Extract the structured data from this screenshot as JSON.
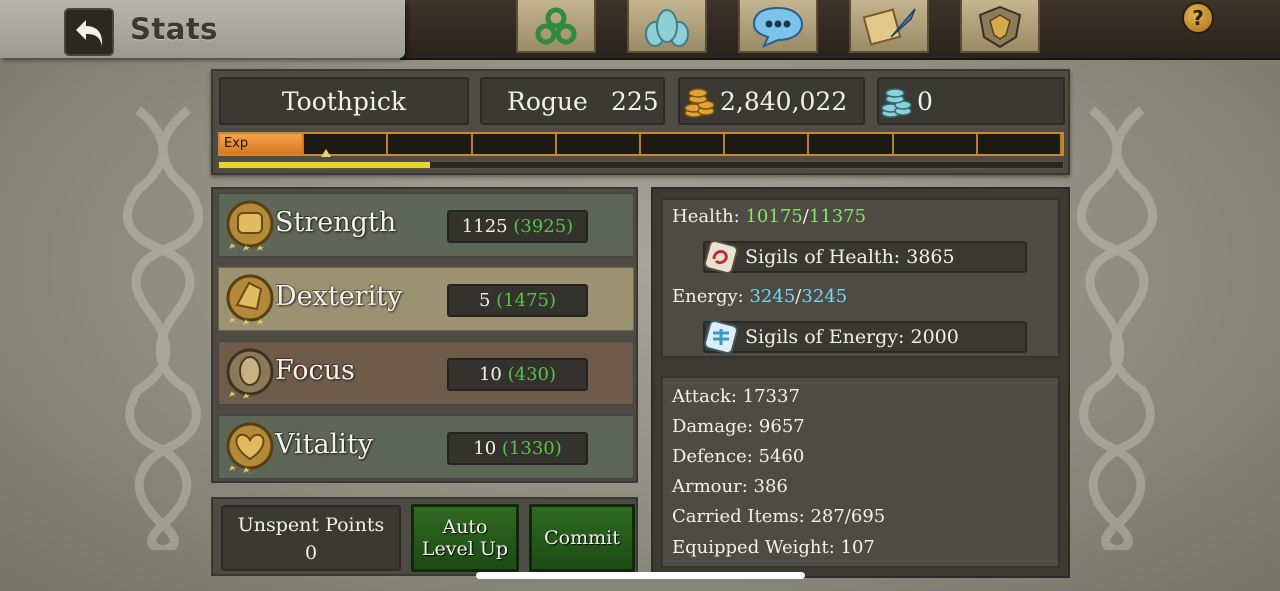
{
  "header": {
    "title": "Stats",
    "help_label": "?"
  },
  "nav": {
    "icons": [
      "triskele-icon",
      "party-icon",
      "chat-icon",
      "scroll-quill-icon",
      "guild-crest-icon"
    ]
  },
  "character": {
    "name": "Toothpick",
    "class": "Rogue",
    "level": "225",
    "gold": "2,840,022",
    "gems": "0",
    "exp_label": "Exp",
    "exp_progress": 0.105,
    "sub_progress": 0.25
  },
  "attributes": [
    {
      "name": "Strength",
      "base": "1125",
      "total": "(3925)",
      "color": "#5d6657"
    },
    {
      "name": "Dexterity",
      "base": "5",
      "total": "(1475)",
      "color": "#9b9272"
    },
    {
      "name": "Focus",
      "base": "10",
      "total": "(430)",
      "color": "#6e5b4a"
    },
    {
      "name": "Vitality",
      "base": "10",
      "total": "(1330)",
      "color": "#5d6657"
    }
  ],
  "points": {
    "label": "Unspent Points",
    "value": "0"
  },
  "buttons": {
    "auto_level_line1": "Auto",
    "auto_level_line2": "Level Up",
    "commit": "Commit"
  },
  "vitals": {
    "health_label": "Health:",
    "health_current": "10175",
    "health_max": "11375",
    "sigils_health": "Sigils of Health: 3865",
    "energy_label": "Energy:",
    "energy_current": "3245",
    "energy_max": "3245",
    "sigils_energy": "Sigils of Energy: 2000",
    "slash": "/"
  },
  "combat": [
    "Attack: 17337",
    "Damage: 9657",
    "Defence: 5460",
    "Armour: 386",
    "Carried Items: 287/695",
    "Equipped Weight: 107"
  ]
}
